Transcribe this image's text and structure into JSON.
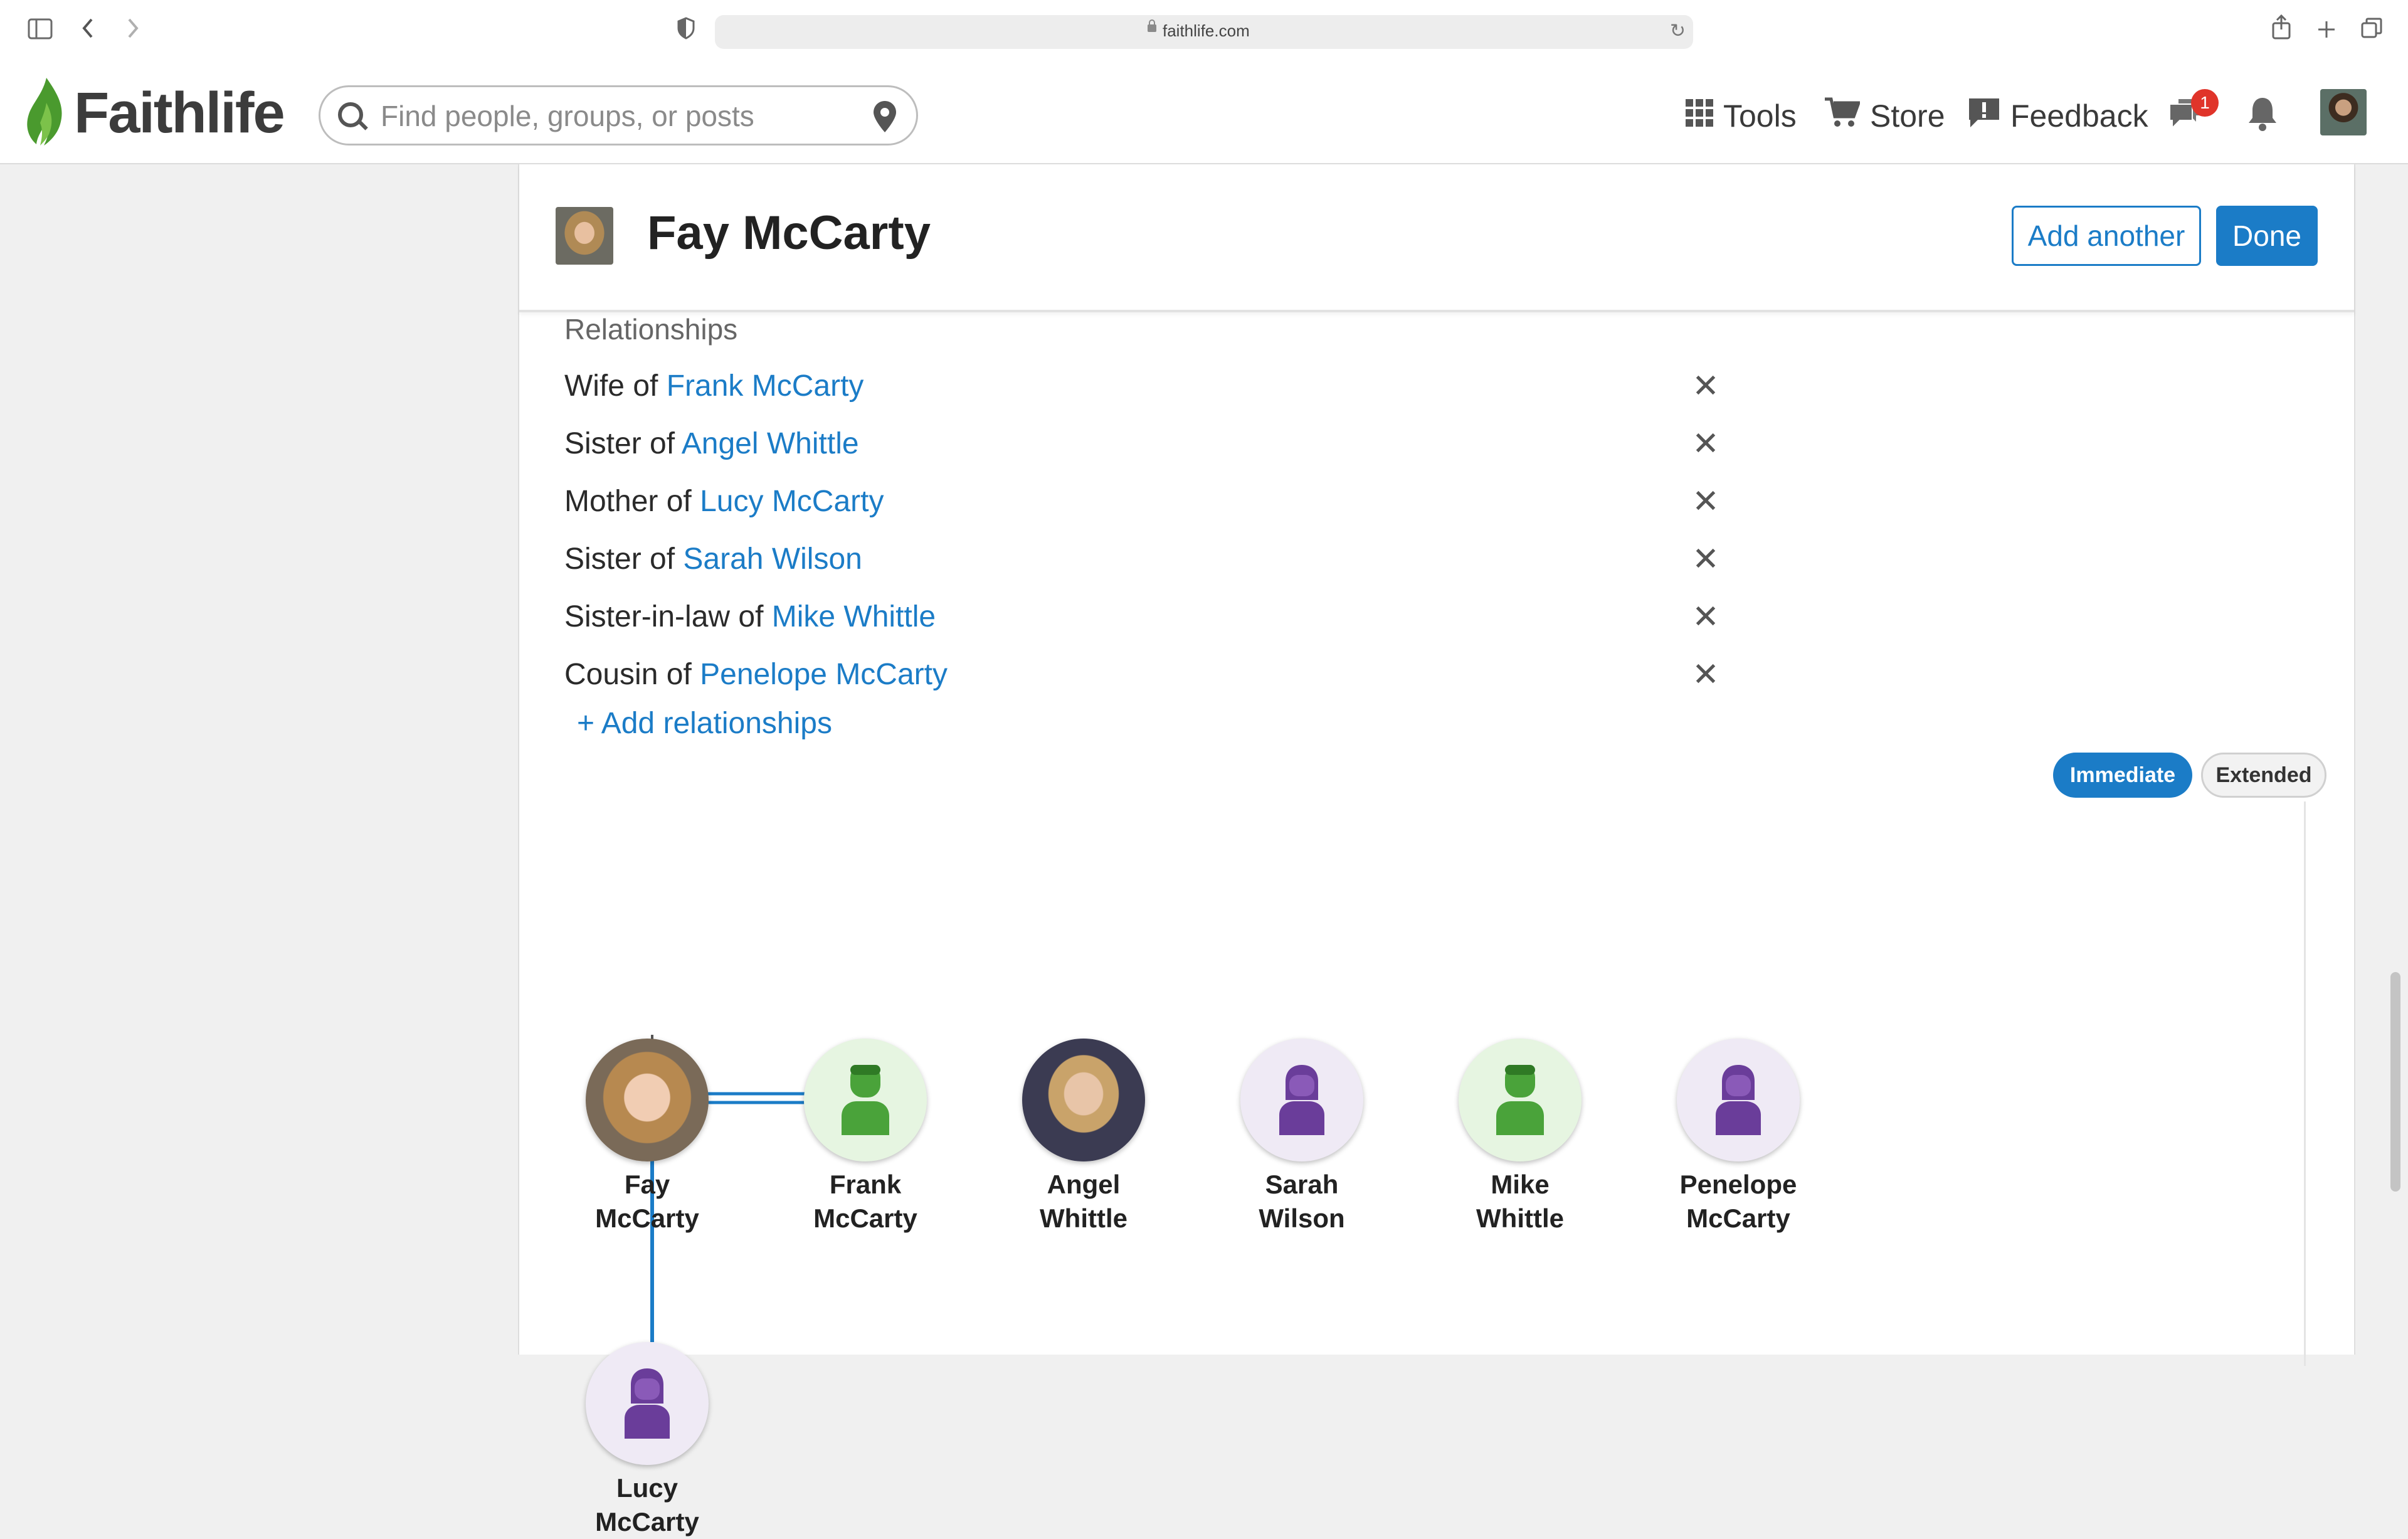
{
  "browser": {
    "url": "faithlife.com",
    "sidebar_icon": "sidebar-icon",
    "back_icon": "back-icon",
    "forward_icon": "forward-icon",
    "shield_icon": "shield-icon",
    "reload_icon": "reload-icon",
    "share_icon": "share-icon",
    "new_tab_icon": "plus-icon",
    "tabs_icon": "tabs-icon"
  },
  "header": {
    "logo_text": "Faithlife",
    "search_placeholder": "Find people, groups, or posts",
    "nav": [
      {
        "label": "Tools",
        "icon": "grid-icon"
      },
      {
        "label": "Store",
        "icon": "cart-icon"
      },
      {
        "label": "Feedback",
        "icon": "feedback-icon"
      }
    ],
    "messages_badge": "1",
    "brand_color": "#4a9a2e",
    "accent_color": "#1b7cc7"
  },
  "person": {
    "name": "Fay McCarty",
    "add_another_label": "Add another",
    "done_label": "Done"
  },
  "relationships": {
    "title": "Relationships",
    "items": [
      {
        "prefix": "Wife of ",
        "name": "Frank McCarty"
      },
      {
        "prefix": "Sister of ",
        "name": "Angel Whittle"
      },
      {
        "prefix": "Mother of ",
        "name": "Lucy McCarty"
      },
      {
        "prefix": "Sister of ",
        "name": "Sarah Wilson"
      },
      {
        "prefix": "Sister-in-law of ",
        "name": "Mike Whittle"
      },
      {
        "prefix": "Cousin of ",
        "name": "Penelope McCarty"
      }
    ],
    "remove_glyph": "✕",
    "add_label": "+ Add relationships"
  },
  "tree": {
    "toggle_immediate": "Immediate",
    "toggle_extended": "Extended",
    "active_view": "Immediate",
    "members": [
      {
        "first": "Fay",
        "last": "McCarty",
        "avatar": "photo"
      },
      {
        "first": "Frank",
        "last": "McCarty",
        "avatar": "male-icon"
      },
      {
        "first": "Angel",
        "last": "Whittle",
        "avatar": "photo"
      },
      {
        "first": "Sarah",
        "last": "Wilson",
        "avatar": "female-icon"
      },
      {
        "first": "Mike",
        "last": "Whittle",
        "avatar": "male-icon"
      },
      {
        "first": "Penelope",
        "last": "McCarty",
        "avatar": "female-icon"
      },
      {
        "first": "Lucy",
        "last": "McCarty",
        "avatar": "female-icon"
      }
    ]
  }
}
